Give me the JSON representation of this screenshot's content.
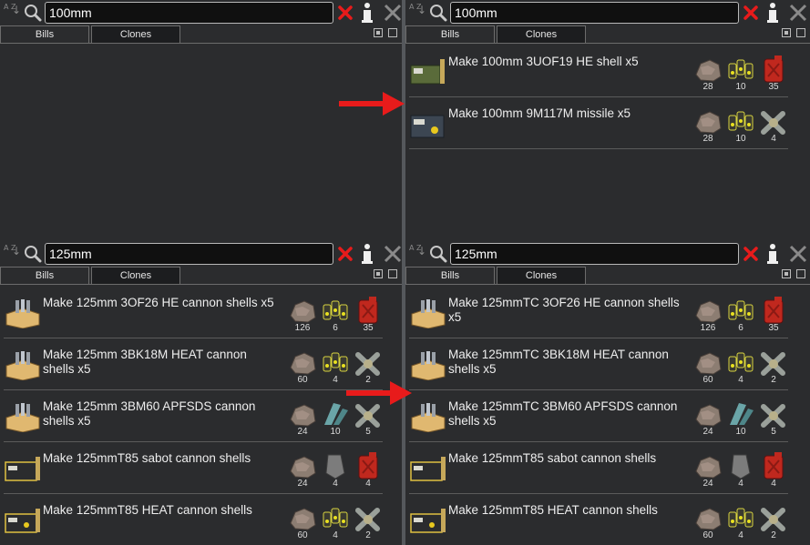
{
  "colors": {
    "accent_red": "#e81b1b",
    "panel_bg": "#2b2c2e",
    "text": "#eeeeee"
  },
  "icons": {
    "sort": "sort-az-icon",
    "search": "magnifier-icon",
    "clear": "red-x-icon",
    "info": "info-icon",
    "close": "close-icon",
    "arrow": "red-arrow-icon"
  },
  "sort_label": "A Z",
  "tabs": {
    "bills": "Bills",
    "clones": "Clones"
  },
  "panels": {
    "top_left": {
      "search": "100mm",
      "bills": []
    },
    "top_right": {
      "search": "100mm",
      "bills": [
        {
          "label": "Make 100mm 3UOF19 HE shell x5",
          "icon": "he-shell-crate-icon",
          "ingredients": [
            {
              "icon": "steel-icon",
              "count": "28"
            },
            {
              "icon": "components-icon",
              "count": "10"
            },
            {
              "icon": "chemfuel-can-icon",
              "count": "35"
            }
          ]
        },
        {
          "label": "Make 100mm 9M117M missile x5",
          "icon": "missile-crate-icon",
          "ingredients": [
            {
              "icon": "steel-icon",
              "count": "28"
            },
            {
              "icon": "components-icon",
              "count": "10"
            },
            {
              "icon": "advanced-component-icon",
              "count": "4"
            }
          ]
        }
      ]
    },
    "bottom_left": {
      "search": "125mm",
      "bills": [
        {
          "label": "Make 125mm 3OF26 HE cannon shells x5",
          "icon": "shell-box-icon",
          "ingredients": [
            {
              "icon": "steel-icon",
              "count": "126"
            },
            {
              "icon": "components-icon",
              "count": "6"
            },
            {
              "icon": "chemfuel-can-icon",
              "count": "35"
            }
          ]
        },
        {
          "label": "Make 125mm 3BK18M HEAT cannon shells x5",
          "icon": "shell-box-icon",
          "ingredients": [
            {
              "icon": "steel-icon",
              "count": "60"
            },
            {
              "icon": "components-icon",
              "count": "4"
            },
            {
              "icon": "advanced-component-icon",
              "count": "2"
            }
          ]
        },
        {
          "label": "Make 125mm 3BM60 APFSDS cannon shells x5",
          "icon": "shell-box-icon",
          "ingredients": [
            {
              "icon": "steel-icon",
              "count": "24"
            },
            {
              "icon": "plasteel-icon",
              "count": "10"
            },
            {
              "icon": "advanced-component-icon",
              "count": "5"
            }
          ]
        },
        {
          "label": "Make 125mmT85 sabot cannon shells",
          "icon": "sabot-crate-icon",
          "ingredients": [
            {
              "icon": "steel-icon",
              "count": "24"
            },
            {
              "icon": "slate-icon",
              "count": "4"
            },
            {
              "icon": "chemfuel-can-icon",
              "count": "4"
            }
          ]
        },
        {
          "label": "Make 125mmT85 HEAT cannon shells",
          "icon": "heat-crate-icon",
          "ingredients": [
            {
              "icon": "steel-icon",
              "count": "60"
            },
            {
              "icon": "components-icon",
              "count": "4"
            },
            {
              "icon": "advanced-component-icon",
              "count": "2"
            }
          ]
        }
      ]
    },
    "bottom_right": {
      "search": "125mm",
      "bills": [
        {
          "label": "Make 125mmTC 3OF26 HE cannon shells x5",
          "icon": "shell-box-icon",
          "ingredients": [
            {
              "icon": "steel-icon",
              "count": "126"
            },
            {
              "icon": "components-icon",
              "count": "6"
            },
            {
              "icon": "chemfuel-can-icon",
              "count": "35"
            }
          ]
        },
        {
          "label": "Make 125mmTC 3BK18M HEAT cannon shells x5",
          "icon": "shell-box-icon",
          "ingredients": [
            {
              "icon": "steel-icon",
              "count": "60"
            },
            {
              "icon": "components-icon",
              "count": "4"
            },
            {
              "icon": "advanced-component-icon",
              "count": "2"
            }
          ]
        },
        {
          "label": "Make 125mmTC 3BM60 APFSDS cannon shells x5",
          "icon": "shell-box-icon",
          "ingredients": [
            {
              "icon": "steel-icon",
              "count": "24"
            },
            {
              "icon": "plasteel-icon",
              "count": "10"
            },
            {
              "icon": "advanced-component-icon",
              "count": "5"
            }
          ]
        },
        {
          "label": "Make 125mmT85 sabot cannon shells",
          "icon": "sabot-crate-icon",
          "ingredients": [
            {
              "icon": "steel-icon",
              "count": "24"
            },
            {
              "icon": "slate-icon",
              "count": "4"
            },
            {
              "icon": "chemfuel-can-icon",
              "count": "4"
            }
          ]
        },
        {
          "label": "Make 125mmT85 HEAT cannon shells",
          "icon": "heat-crate-icon",
          "ingredients": [
            {
              "icon": "steel-icon",
              "count": "60"
            },
            {
              "icon": "components-icon",
              "count": "4"
            },
            {
              "icon": "advanced-component-icon",
              "count": "2"
            }
          ]
        }
      ]
    }
  }
}
